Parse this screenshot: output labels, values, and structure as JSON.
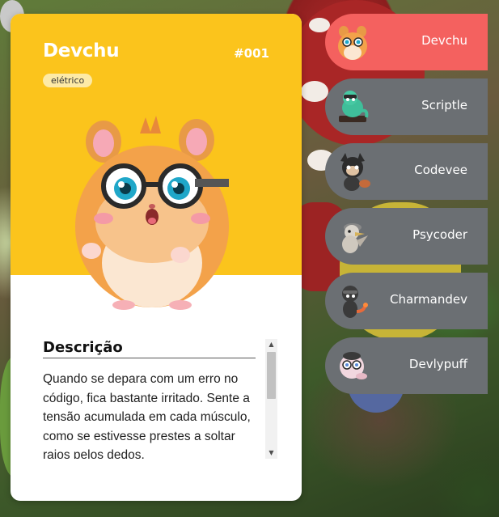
{
  "card": {
    "name": "Devchu",
    "number": "#001",
    "type": "elétrico",
    "header_color": "#fbc41c",
    "description_title": "Descrição",
    "description": "Quando se depara com um erro no código, fica bastante irritado. Sente a tensão acumulada em cada músculo, como se estivesse prestes a soltar raios pelos dedos."
  },
  "scrollbar": {
    "up_icon": "▲",
    "down_icon": "▼"
  },
  "colors": {
    "active": "#f4615f",
    "inactive": "#6b6f73"
  },
  "sidebar": {
    "items": [
      {
        "label": "Devchu",
        "icon": "hamster-avatar",
        "active": true
      },
      {
        "label": "Scriptle",
        "icon": "turtle-avatar",
        "active": false
      },
      {
        "label": "Codevee",
        "icon": "fox-avatar",
        "active": false
      },
      {
        "label": "Psycoder",
        "icon": "duck-avatar",
        "active": false
      },
      {
        "label": "Charmandev",
        "icon": "lizard-avatar",
        "active": false
      },
      {
        "label": "Devlypuff",
        "icon": "puff-avatar",
        "active": false
      }
    ]
  }
}
